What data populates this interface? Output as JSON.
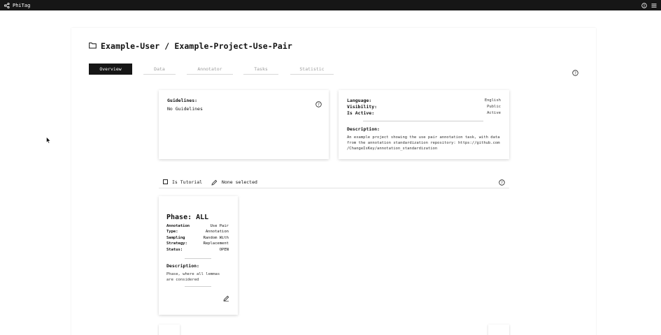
{
  "app": {
    "name": "PhiTag"
  },
  "header": {
    "title": "Example-User / Example-Project-Use-Pair"
  },
  "tabs": [
    {
      "label": "Overview",
      "active": true
    },
    {
      "label": "Data",
      "active": false
    },
    {
      "label": "Annotator",
      "active": false
    },
    {
      "label": "Tasks",
      "active": false
    },
    {
      "label": "Statistic",
      "active": false
    }
  ],
  "guidelines": {
    "label": "Guidelines:",
    "value": "No Guidelines"
  },
  "info": {
    "language_label": "Language:",
    "language": "English",
    "visibility_label": "Visibility:",
    "visibility": "Public",
    "active_label": "Is Active:",
    "active": "Active",
    "description_label": "Description:",
    "description_lines": [
      "An example project showing the use pair annotation task, with data",
      "from the annotation standardization repository: https://github.com",
      "/ChangeIsKey/annotation_standardization"
    ]
  },
  "toolbar": {
    "tutorial_label": "Is Tutorial",
    "selection_label": "None selected"
  },
  "phase": {
    "title": "Phase: ALL",
    "annotation_type_label_1": "Annotation",
    "annotation_type_label_2": "Type:",
    "annotation_type_value_1": "Use Pair",
    "annotation_type_value_2": "Annotation",
    "sampling_label_1": "Sampling",
    "sampling_label_2": "Strategy:",
    "sampling_value_1": "Random With",
    "sampling_value_2": "Replacement",
    "status_label": "Status:",
    "status_value": "OPEN",
    "description_label": "Description:",
    "description_line_1": "Phase, where all lemmas",
    "description_line_2": "are considered"
  },
  "icons": {
    "logo": "share-nodes-icon",
    "folder": "folder-icon",
    "help": "help-circle-icon",
    "edit": "pencil-icon",
    "prev": "arrow-left-icon",
    "next": "arrow-right-icon"
  },
  "colors": {
    "topbar": "#161616",
    "active_tab": "#161616"
  }
}
